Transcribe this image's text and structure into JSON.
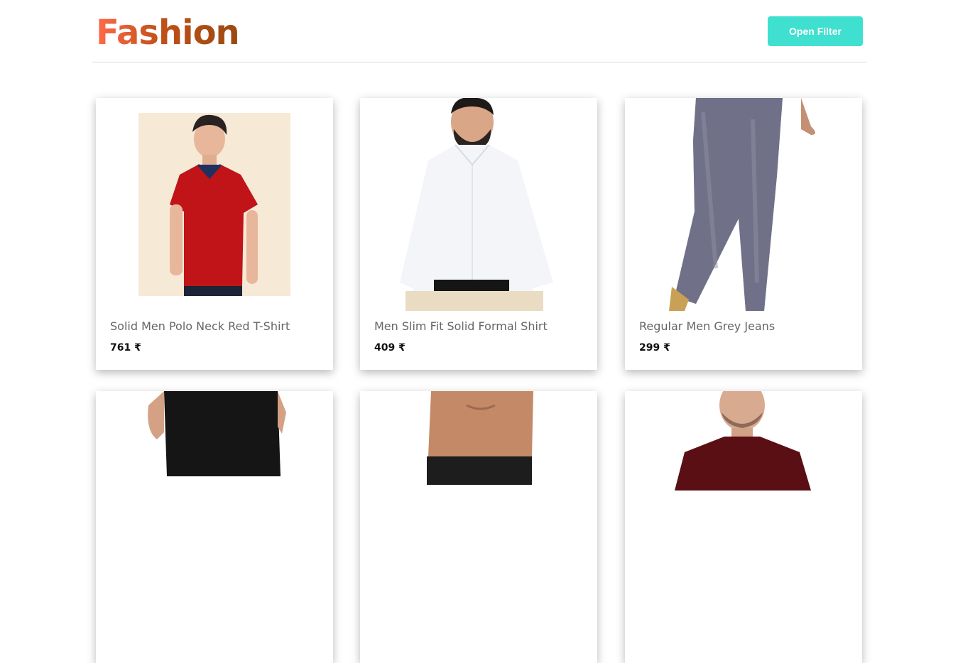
{
  "header": {
    "brand": "Fashion",
    "filter_button": "Open Filter"
  },
  "products": [
    {
      "title": "Solid Men Polo Neck Red T-Shirt",
      "price": "761 ₹"
    },
    {
      "title": "Men Slim Fit Solid Formal Shirt",
      "price": "409 ₹"
    },
    {
      "title": "Regular Men Grey Jeans",
      "price": "299 ₹"
    },
    {
      "title": "",
      "price": ""
    },
    {
      "title": "",
      "price": ""
    },
    {
      "title": "",
      "price": ""
    }
  ],
  "colors": {
    "accent": "#40e0d0",
    "brand_start": "#ff6b4a",
    "brand_end": "#9a4a12"
  }
}
